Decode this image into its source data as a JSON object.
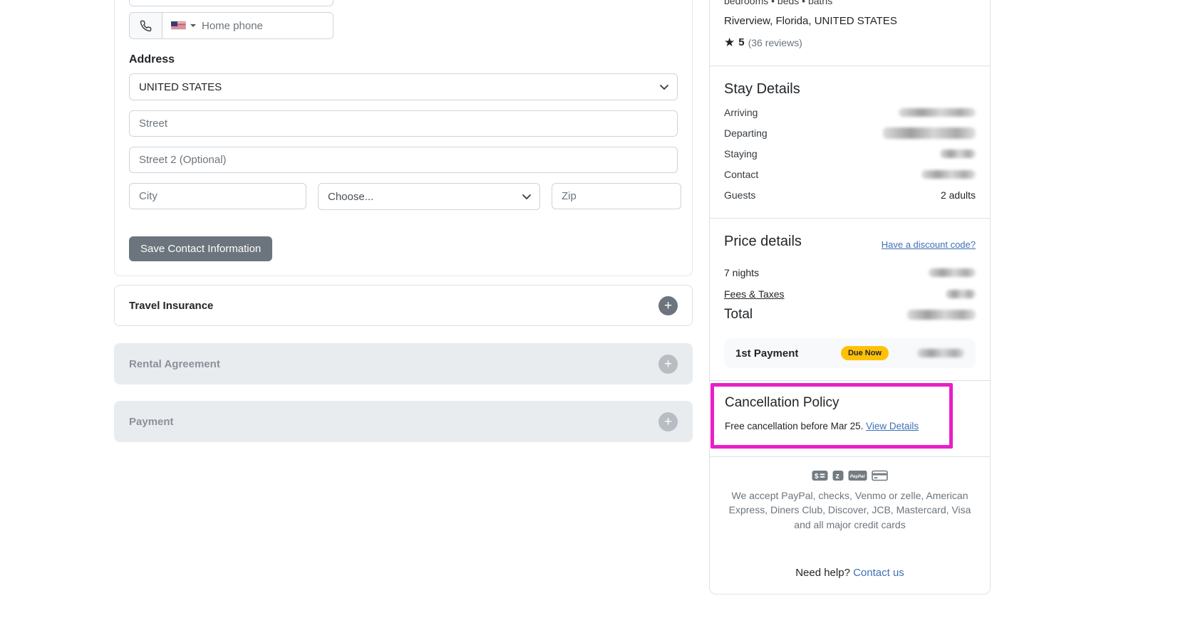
{
  "form": {
    "phone": {
      "placeholder": "Home phone",
      "country_flag": "us"
    },
    "address_heading": "Address",
    "country_value": "UNITED STATES",
    "street_placeholder": "Street",
    "street2_placeholder": "Street 2 (Optional)",
    "city_placeholder": "City",
    "state_value": "Choose...",
    "zip_placeholder": "Zip",
    "save_button": "Save Contact Information"
  },
  "accordions": [
    {
      "label": "Travel Insurance",
      "enabled": true
    },
    {
      "label": "Rental Agreement",
      "enabled": false
    },
    {
      "label": "Payment",
      "enabled": false
    }
  ],
  "summary": {
    "property_meta": "bedrooms • beds • baths",
    "location": "Riverview, Florida, UNITED STATES",
    "rating": {
      "score": "5",
      "reviews": "(36 reviews)"
    },
    "stay": {
      "title": "Stay Details",
      "rows": [
        {
          "label": "Arriving",
          "value": "",
          "redacted": true
        },
        {
          "label": "Departing",
          "value": "",
          "redacted": true
        },
        {
          "label": "Staying",
          "value": "",
          "redacted": true
        },
        {
          "label": "Contact",
          "value": "",
          "redacted": true
        },
        {
          "label": "Guests",
          "value": "2 adults",
          "redacted": false
        }
      ]
    },
    "price": {
      "title": "Price details",
      "discount_link": "Have a discount code?",
      "nights_label": "7 nights",
      "fees_label": "Fees & Taxes",
      "total_label": "Total",
      "first_payment_label": "1st Payment",
      "due_badge": "Due Now"
    },
    "cancellation": {
      "title": "Cancellation Policy",
      "text": "Free cancellation before Mar 25. ",
      "link": "View Details"
    },
    "payments": {
      "icons": [
        "money-check-icon",
        "zelle-icon",
        "paypal-icon",
        "credit-card-icon"
      ],
      "accept_text": "We accept PayPal, checks, Venmo or zelle, American Express, Diners Club, Discover, JCB, Mastercard, Visa and all major credit cards"
    },
    "help": {
      "text": "Need help?",
      "link": "Contact us"
    }
  },
  "colors": {
    "highlight_magenta": "#e91fc6",
    "due_badge_yellow": "#ffc107",
    "link_blue": "#3e70b5",
    "button_gray": "#6c757d"
  }
}
